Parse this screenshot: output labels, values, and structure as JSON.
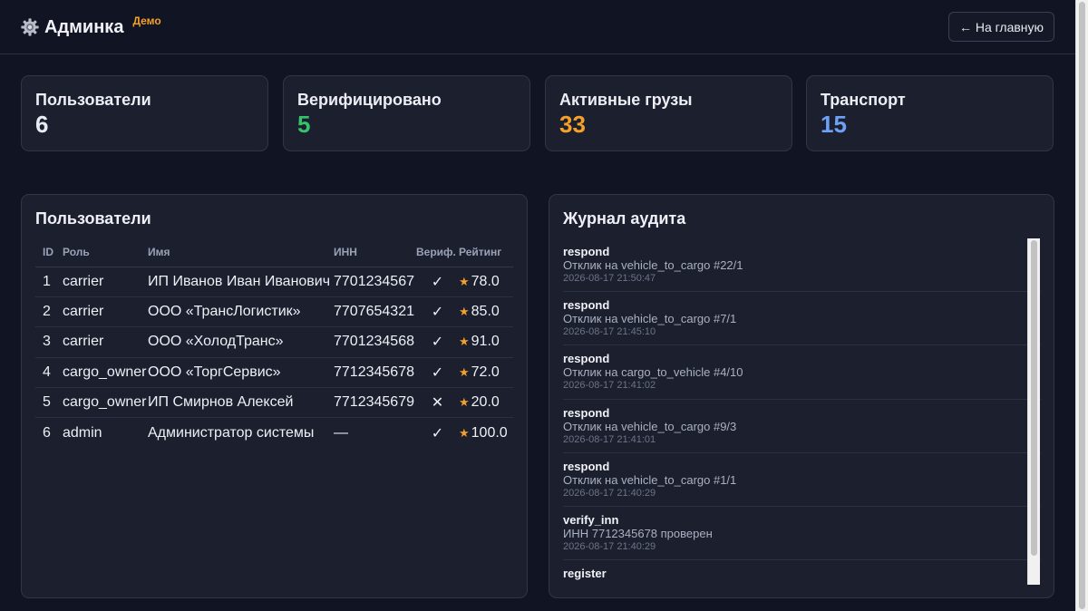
{
  "header": {
    "title": "Админка",
    "badge": "Демо",
    "home_button": "← На главную",
    "icon": "gear-icon"
  },
  "stats": [
    {
      "label": "Пользователи",
      "value": "6",
      "color": "#e9ebf2"
    },
    {
      "label": "Верифицировано",
      "value": "5",
      "color": "#34c26b"
    },
    {
      "label": "Активные грузы",
      "value": "33",
      "color": "#f5a028"
    },
    {
      "label": "Транспорт",
      "value": "15",
      "color": "#6ea0f7"
    }
  ],
  "users_panel": {
    "title": "Пользователи",
    "columns": [
      "ID",
      "Роль",
      "Имя",
      "ИНН",
      "Вериф.",
      "Рейтинг"
    ],
    "rows": [
      {
        "id": "1",
        "role": "carrier",
        "name": "ИП Иванов Иван Иванович",
        "inn": "7701234567",
        "verified": "✓",
        "rating": "78.0"
      },
      {
        "id": "2",
        "role": "carrier",
        "name": "ООО «ТрансЛогистик»",
        "inn": "7707654321",
        "verified": "✓",
        "rating": "85.0"
      },
      {
        "id": "3",
        "role": "carrier",
        "name": "ООО «ХолодТранс»",
        "inn": "7701234568",
        "verified": "✓",
        "rating": "91.0"
      },
      {
        "id": "4",
        "role": "cargo_owner",
        "name": "ООО «ТоргСервис»",
        "inn": "7712345678",
        "verified": "✓",
        "rating": "72.0"
      },
      {
        "id": "5",
        "role": "cargo_owner",
        "name": "ИП Смирнов Алексей",
        "inn": "7712345679",
        "verified": "✕",
        "rating": "20.0"
      },
      {
        "id": "6",
        "role": "admin",
        "name": "Администратор системы",
        "inn": "—",
        "verified": "✓",
        "rating": "100.0"
      }
    ]
  },
  "audit_panel": {
    "title": "Журнал аудита",
    "items": [
      {
        "action": "respond",
        "desc": "Отклик на vehicle_to_cargo #22/1",
        "time": "2026-08-17 21:50:47"
      },
      {
        "action": "respond",
        "desc": "Отклик на vehicle_to_cargo #7/1",
        "time": "2026-08-17 21:45:10"
      },
      {
        "action": "respond",
        "desc": "Отклик на cargo_to_vehicle #4/10",
        "time": "2026-08-17 21:41:02"
      },
      {
        "action": "respond",
        "desc": "Отклик на vehicle_to_cargo #9/3",
        "time": "2026-08-17 21:41:01"
      },
      {
        "action": "respond",
        "desc": "Отклик на vehicle_to_cargo #1/1",
        "time": "2026-08-17 21:40:29"
      },
      {
        "action": "verify_inn",
        "desc": "ИНН 7712345678 проверен",
        "time": "2026-08-17 21:40:29"
      },
      {
        "action": "register",
        "desc": "",
        "time": ""
      }
    ]
  },
  "colors": {
    "background": "#111422",
    "card": "#1b1f2e",
    "accent": "#f5a028",
    "success": "#34c26b",
    "info": "#6ea0f7"
  }
}
